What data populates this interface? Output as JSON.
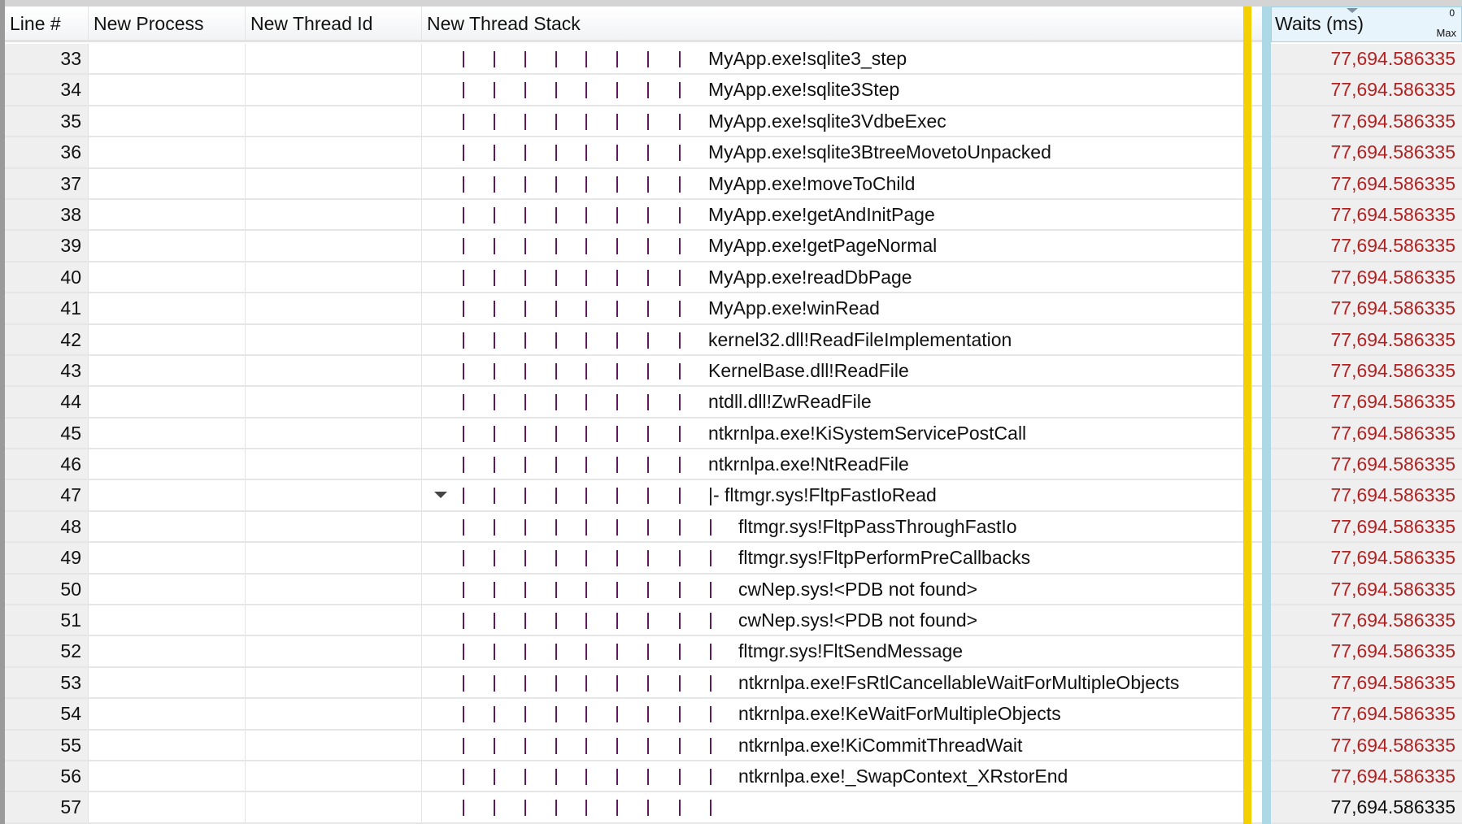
{
  "columns": {
    "line": "Line #",
    "process": "New Process",
    "thread_id": "New Thread Id",
    "stack": "New Thread Stack",
    "waits": "Waits (ms)",
    "waits_zero": "0",
    "waits_max": "Max"
  },
  "colors": {
    "value_highlight": "#b22222",
    "divider_yellow": "#f5d000",
    "divider_blue": "#add8e6",
    "tree_pipe": "#5e1a5c"
  },
  "rows": [
    {
      "line": "33",
      "depth": 8,
      "text": "MyApp.exe!sqlite3_step",
      "value": "77,694.586335",
      "highlight": true
    },
    {
      "line": "34",
      "depth": 8,
      "text": "MyApp.exe!sqlite3Step",
      "value": "77,694.586335",
      "highlight": true
    },
    {
      "line": "35",
      "depth": 8,
      "text": "MyApp.exe!sqlite3VdbeExec",
      "value": "77,694.586335",
      "highlight": true
    },
    {
      "line": "36",
      "depth": 8,
      "text": "MyApp.exe!sqlite3BtreeMovetoUnpacked",
      "value": "77,694.586335",
      "highlight": true
    },
    {
      "line": "37",
      "depth": 8,
      "text": "MyApp.exe!moveToChild",
      "value": "77,694.586335",
      "highlight": true
    },
    {
      "line": "38",
      "depth": 8,
      "text": "MyApp.exe!getAndInitPage",
      "value": "77,694.586335",
      "highlight": true
    },
    {
      "line": "39",
      "depth": 8,
      "text": "MyApp.exe!getPageNormal",
      "value": "77,694.586335",
      "highlight": true
    },
    {
      "line": "40",
      "depth": 8,
      "text": "MyApp.exe!readDbPage",
      "value": "77,694.586335",
      "highlight": true
    },
    {
      "line": "41",
      "depth": 8,
      "text": "MyApp.exe!winRead",
      "value": "77,694.586335",
      "highlight": true
    },
    {
      "line": "42",
      "depth": 8,
      "text": "kernel32.dll!ReadFileImplementation",
      "value": "77,694.586335",
      "highlight": true
    },
    {
      "line": "43",
      "depth": 8,
      "text": "KernelBase.dll!ReadFile",
      "value": "77,694.586335",
      "highlight": true
    },
    {
      "line": "44",
      "depth": 8,
      "text": "ntdll.dll!ZwReadFile",
      "value": "77,694.586335",
      "highlight": true
    },
    {
      "line": "45",
      "depth": 8,
      "text": "ntkrnlpa.exe!KiSystemServicePostCall",
      "value": "77,694.586335",
      "highlight": true
    },
    {
      "line": "46",
      "depth": 8,
      "text": "ntkrnlpa.exe!NtReadFile",
      "value": "77,694.586335",
      "highlight": true
    },
    {
      "line": "47",
      "depth": 8,
      "text": "|- fltmgr.sys!FltpFastIoRead",
      "value": "77,694.586335",
      "highlight": true,
      "expanded": true
    },
    {
      "line": "48",
      "depth": 9,
      "text": "fltmgr.sys!FltpPassThroughFastIo",
      "value": "77,694.586335",
      "highlight": true
    },
    {
      "line": "49",
      "depth": 9,
      "text": "fltmgr.sys!FltpPerformPreCallbacks",
      "value": "77,694.586335",
      "highlight": true
    },
    {
      "line": "50",
      "depth": 9,
      "text": "cwNep.sys!<PDB not found>",
      "value": "77,694.586335",
      "highlight": true
    },
    {
      "line": "51",
      "depth": 9,
      "text": "cwNep.sys!<PDB not found>",
      "value": "77,694.586335",
      "highlight": true
    },
    {
      "line": "52",
      "depth": 9,
      "text": "fltmgr.sys!FltSendMessage",
      "value": "77,694.586335",
      "highlight": true
    },
    {
      "line": "53",
      "depth": 9,
      "text": "ntkrnlpa.exe!FsRtlCancellableWaitForMultipleObjects",
      "value": "77,694.586335",
      "highlight": true
    },
    {
      "line": "54",
      "depth": 9,
      "text": "ntkrnlpa.exe!KeWaitForMultipleObjects",
      "value": "77,694.586335",
      "highlight": true
    },
    {
      "line": "55",
      "depth": 9,
      "text": "ntkrnlpa.exe!KiCommitThreadWait",
      "value": "77,694.586335",
      "highlight": true
    },
    {
      "line": "56",
      "depth": 9,
      "text": "ntkrnlpa.exe!_SwapContext_XRstorEnd",
      "value": "77,694.586335",
      "highlight": true
    },
    {
      "line": "57",
      "depth": 9,
      "text": "",
      "value": "77,694.586335",
      "highlight": false
    }
  ]
}
